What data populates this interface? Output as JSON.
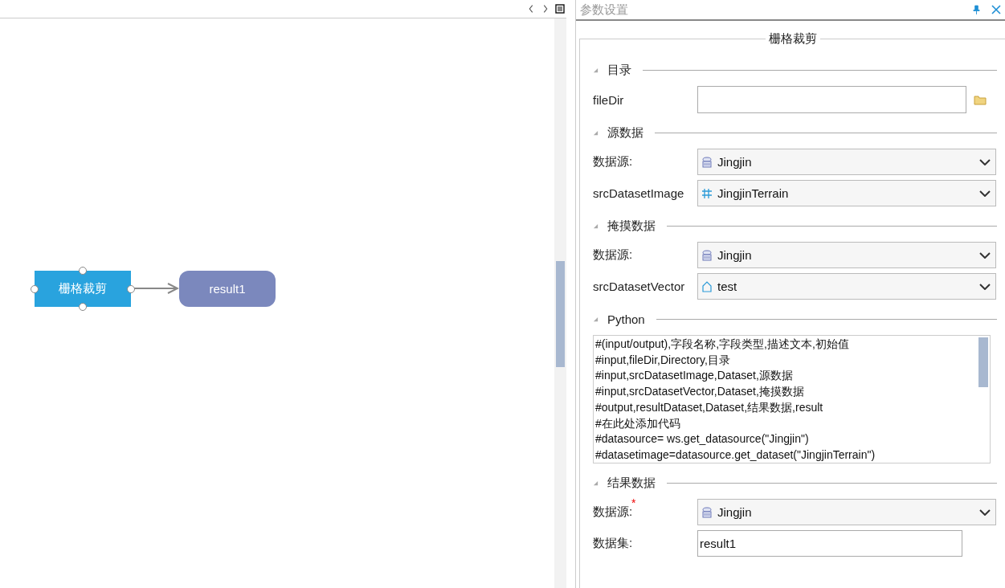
{
  "panel": {
    "title": "参数设置"
  },
  "canvas": {
    "nodes": [
      {
        "label": "栅格裁剪",
        "kind": "process",
        "selected": true
      },
      {
        "label": "result1",
        "kind": "output",
        "selected": false
      }
    ]
  },
  "group": {
    "title": "栅格裁剪"
  },
  "sections": [
    {
      "title": "目录",
      "expanded": true,
      "fields": [
        {
          "kind": "folder",
          "label": "fileDir"
        }
      ]
    },
    {
      "title": "源数据",
      "expanded": true,
      "fields": [
        {
          "kind": "datasource",
          "label": "数据源:",
          "value": "Jingjin"
        },
        {
          "kind": "raster",
          "label": "srcDatasetImage",
          "value": "JingjinTerrain"
        }
      ]
    },
    {
      "title": "掩摸数据",
      "expanded": true,
      "fields": [
        {
          "kind": "datasource",
          "label": "数据源:",
          "value": "Jingjin"
        },
        {
          "kind": "vector",
          "label": "srcDatasetVector",
          "value": "test"
        }
      ]
    },
    {
      "title": "Python",
      "expanded": true,
      "fields": [
        {
          "kind": "code",
          "lines": [
            "#(input/output),字段名称,字段类型,描述文本,初始值",
            "#input,fileDir,Directory,目录",
            "#input,srcDatasetImage,Dataset,源数据",
            "#input,srcDatasetVector,Dataset,掩摸数据",
            "#output,resultDataset,Dataset,结果数据,result",
            "#在此处添加代码",
            "#datasource= ws.get_datasource(\"Jingjin\")",
            "#datasetimage=datasource.get_dataset(\"JingjinTerrain\")"
          ]
        }
      ]
    },
    {
      "title": "结果数据",
      "expanded": true,
      "fields": [
        {
          "kind": "datasource",
          "label": "数据源:",
          "value": "Jingjin",
          "required_mark": "*"
        },
        {
          "kind": "text",
          "label": "数据集:",
          "value": "result1"
        }
      ]
    }
  ]
}
